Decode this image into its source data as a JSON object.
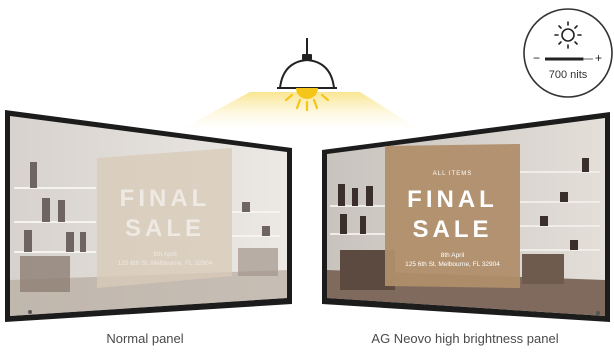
{
  "brightness_badge": {
    "value_label": "700 nits",
    "level_fraction": 0.8,
    "sun_icon": "sun-icon",
    "minus_symbol": "−",
    "plus_symbol": "+"
  },
  "lamp": {
    "icon": "pendant-lamp-icon",
    "light_color": "#f5c518"
  },
  "panels": {
    "normal": {
      "caption": "Normal panel",
      "sale_line1": "FINAL",
      "sale_line2": "SALE",
      "date": "8th April",
      "address": "125 6th St. Melbourne, FL 32904"
    },
    "bright": {
      "caption": "AG Neovo high brightness panel",
      "kicker": "ALL ITEMS",
      "sale_line1": "FINAL",
      "sale_line2": "SALE",
      "date": "8th April",
      "address": "125 6th St. Melbourne, FL 32904"
    }
  },
  "colors": {
    "bezel": "#1c1c1c",
    "sign_normal": "#d9cbb8",
    "sign_bright": "#b08e6a"
  }
}
